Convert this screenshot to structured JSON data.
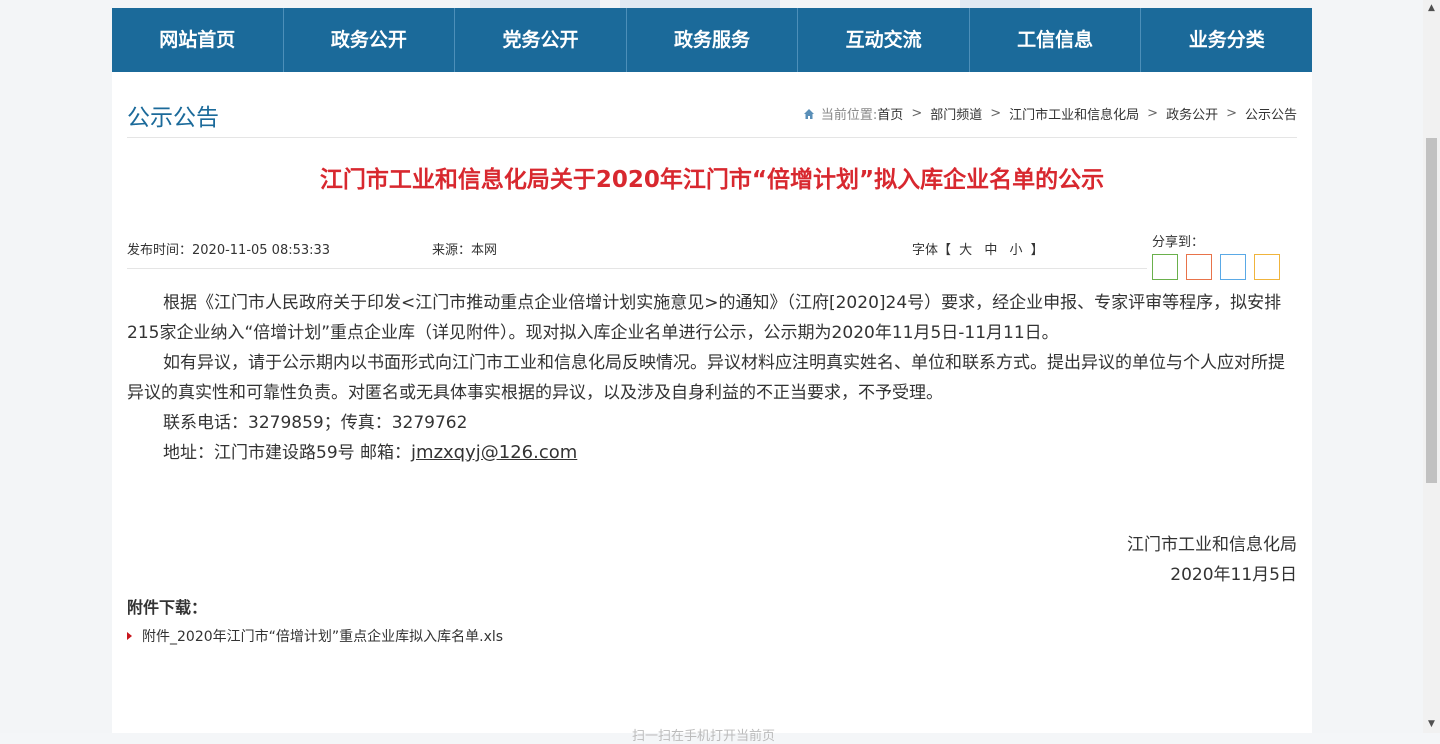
{
  "nav": {
    "items": [
      "网站首页",
      "政务公开",
      "党务公开",
      "政务服务",
      "互动交流",
      "工信信息",
      "业务分类"
    ]
  },
  "section": {
    "title": "公示公告"
  },
  "breadcrumb": {
    "prefix": "当前位置:",
    "items": [
      "首页",
      "部门频道",
      "江门市工业和信息化局",
      "政务公开",
      "公示公告"
    ],
    "separator": ">"
  },
  "article": {
    "title": "江门市工业和信息化局关于2020年江门市“倍增计划”拟入库企业名单的公示",
    "publish_time": "发布时间：2020-11-05 08:53:33",
    "source": "来源：本网",
    "font_label": "字体【",
    "font_close": "】",
    "font_options": [
      "大",
      "中",
      "小"
    ],
    "share_label": "分享到：",
    "paragraphs": [
      "根据《江门市人民政府关于印发<江门市推动重点企业倍增计划实施意见>的通知》（江府[2020]24号）要求，经企业申报、专家评审等程序，拟安排215家企业纳入“倍增计划”重点企业库（详见附件）。现对拟入库企业名单进行公示，公示期为2020年11月5日-11月11日。",
      "如有异议，请于公示期内以书面形式向江门市工业和信息化局反映情况。异议材料应注明真实姓名、单位和联系方式。提出异议的单位与个人应对所提异议的真实性和可靠性负责。对匿名或无具体事实根据的异议，以及涉及自身利益的不正当要求，不予受理。",
      "联系电话：3279859；传真：3279762"
    ],
    "address_prefix": "地址：江门市建设路59号  邮箱：",
    "email": "jmzxqyj@126.com",
    "sign_org": "江门市工业和信息化局",
    "sign_date": "2020年11月5日"
  },
  "attachments": {
    "title": "附件下载：",
    "items": [
      "附件_2020年江门市“倍增计划”重点企业库拟入库名单.xls"
    ]
  },
  "footer": {
    "hint": "扫一扫在手机打开当前页"
  },
  "colors": {
    "nav_bg": "#1b6a9a",
    "title_red": "#d8282f",
    "section_blue": "#1b6a9a",
    "share_green": "#6ab04c",
    "share_orange": "#e8734a",
    "share_blue": "#5aa9e6",
    "share_yellow": "#f0b43c"
  }
}
